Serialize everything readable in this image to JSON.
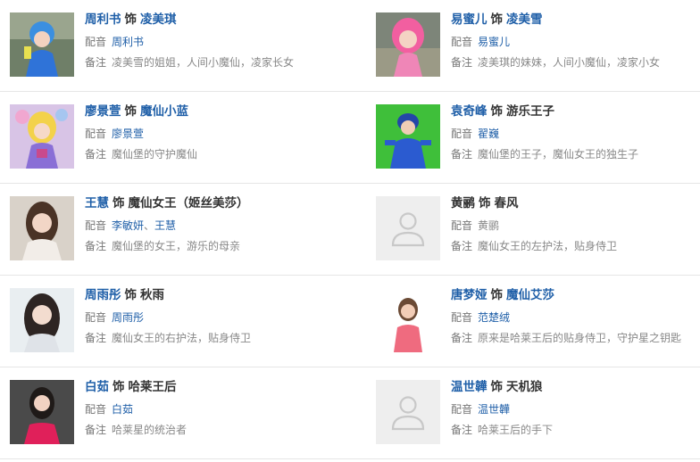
{
  "labels": {
    "dub": "配音",
    "note": "备注",
    "as": "饰"
  },
  "cast": [
    {
      "actor": "周利书",
      "role": "凌美琪",
      "role_link": true,
      "dub": [
        "周利书"
      ],
      "note": "凌美雪的姐姐，人间小魔仙，凌家长女",
      "thumb": "photo-girl-blue-costume"
    },
    {
      "actor": "易蜜儿",
      "role": "凌美雪",
      "role_link": true,
      "dub": [
        "易蜜儿"
      ],
      "note": "凌美琪的妹妹，人间小魔仙，凌家小女",
      "thumb": "photo-girl-pink-hair"
    },
    {
      "actor": "廖景萱",
      "role": "魔仙小蓝",
      "role_link": true,
      "dub": [
        "廖景萱"
      ],
      "note": "魔仙堡的守护魔仙",
      "thumb": "photo-fairy-blonde"
    },
    {
      "actor": "袁奇峰",
      "role": "游乐王子",
      "role_link": false,
      "dub": [
        "翟巍"
      ],
      "note": "魔仙堡的王子，魔仙女王的独生子",
      "thumb": "photo-boy-green-screen"
    },
    {
      "actor": "王慧",
      "role": "魔仙女王（姬丝美莎）",
      "role_link": false,
      "dub": [
        "李敏妍",
        "王慧"
      ],
      "note": "魔仙堡的女王，游乐的母亲",
      "thumb": "photo-woman-portrait"
    },
    {
      "actor": "黄鹂",
      "role": "春风",
      "role_link": false,
      "dub": [
        "黄鹂"
      ],
      "note": "魔仙女王的左护法，贴身侍卫",
      "thumb": "placeholder"
    },
    {
      "actor": "周雨彤",
      "role": "秋雨",
      "role_link": false,
      "dub": [
        "周雨彤"
      ],
      "note": "魔仙女王的右护法，贴身侍卫",
      "thumb": "photo-woman-longhair"
    },
    {
      "actor": "唐梦娅",
      "role": "魔仙艾莎",
      "role_link": true,
      "dub": [
        "范楚绒"
      ],
      "note": "原来是哈莱王后的贴身侍卫，守护星之钥匙",
      "thumb": "photo-woman-pink-top"
    },
    {
      "actor": "白茹",
      "role": "哈莱王后",
      "role_link": false,
      "dub": [
        "白茹"
      ],
      "note": "哈莱星的统治者",
      "thumb": "photo-woman-red-dress"
    },
    {
      "actor": "温世韡",
      "role": "天机狼",
      "role_link": false,
      "dub": [
        "温世韡"
      ],
      "note": "哈莱王后的手下",
      "thumb": "placeholder"
    }
  ]
}
